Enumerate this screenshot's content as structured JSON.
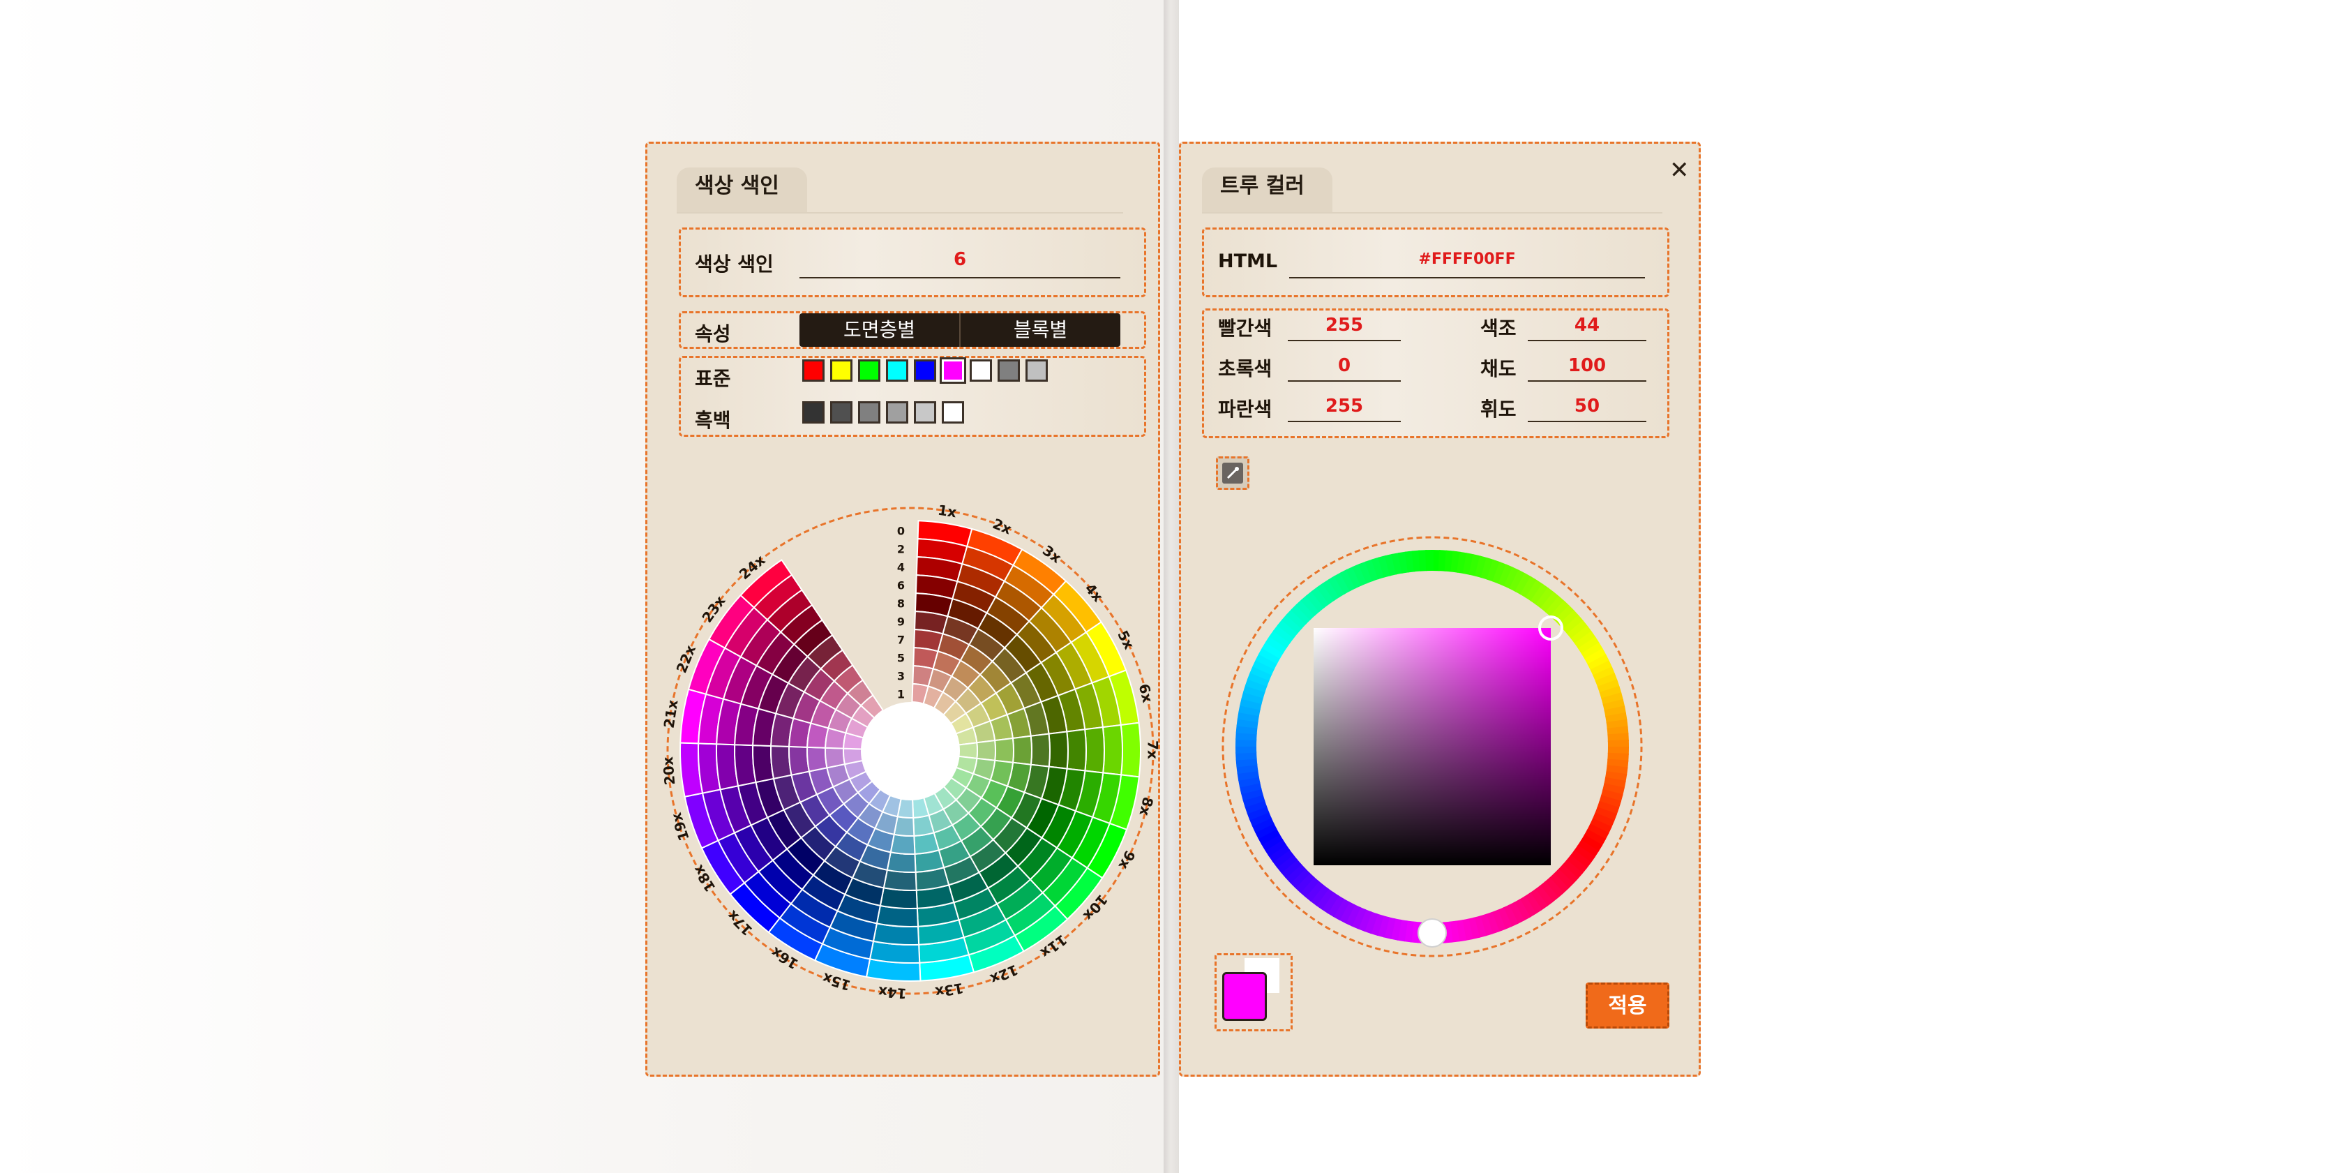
{
  "left_panel": {
    "tab": "색상 색인",
    "index_label": "색상 색인",
    "index_value": "6",
    "attr_label": "속성",
    "attr_options": [
      "도면층별",
      "블록별"
    ],
    "standard_label": "표준",
    "gray_label": "흑백",
    "standard_colors": [
      "#ff0000",
      "#ffff00",
      "#00ff00",
      "#00ffff",
      "#0000ff",
      "#ff00ff",
      "#ffffff",
      "#808080",
      "#c0c0c0"
    ],
    "selected_standard_index": 5,
    "gray_colors": [
      "#333333",
      "#505050",
      "#808080",
      "#a0a0a0",
      "#c8c8c8",
      "#ffffff"
    ],
    "wheel": {
      "hue_labels": [
        "1x",
        "2x",
        "3x",
        "4x",
        "5x",
        "6x",
        "7x",
        "8x",
        "9x",
        "10x",
        "11x",
        "12x",
        "13x",
        "14x",
        "15x",
        "16x",
        "17x",
        "18x",
        "19x",
        "20x",
        "21x",
        "22x",
        "23x",
        "24x"
      ],
      "shade_labels": [
        "0",
        "2",
        "4",
        "6",
        "8",
        "9",
        "7",
        "5",
        "3",
        "1"
      ]
    }
  },
  "right_panel": {
    "tab": "트루 컬러",
    "close_icon": "✕",
    "html_label": "HTML",
    "html_value": "#FFFF00FF",
    "red_label": "빨간색",
    "red_value": "255",
    "green_label": "초록색",
    "green_value": "0",
    "blue_label": "파란색",
    "blue_value": "255",
    "hue_label": "색조",
    "hue_value": "44",
    "sat_label": "채도",
    "sat_value": "100",
    "lum_label": "휘도",
    "lum_value": "50",
    "eyedropper_icon": "eyedropper-icon",
    "current_color": "#ff00ff",
    "apply_label": "적용"
  },
  "colors": {
    "accent": "#f06a1a",
    "border": "#e8742a",
    "panel_bg": "#ebe1d1",
    "value_text": "#e01b1b"
  }
}
